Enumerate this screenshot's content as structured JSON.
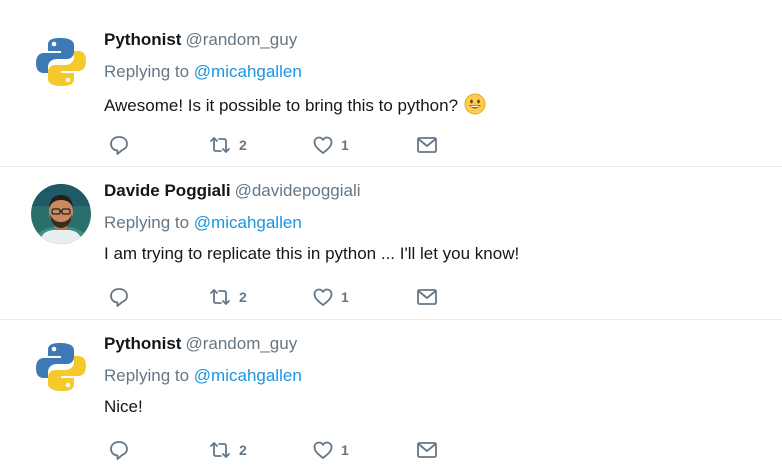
{
  "tweets": [
    {
      "name": "Pythonist",
      "handle": "@random_guy",
      "replying_prefix": "Replying to",
      "replying_to": "@micahgallen",
      "text": "Awesome! Is it possible to bring this to python?",
      "emoji": "grinning-face",
      "avatar": "python-logo",
      "retweets": "2",
      "likes": "1"
    },
    {
      "name": "Davide Poggiali",
      "handle": "@davidepoggiali",
      "replying_prefix": "Replying to",
      "replying_to": "@micahgallen",
      "text": "I am trying to replicate this in python ... I'll let you know!",
      "avatar": "user-photo",
      "retweets": "2",
      "likes": "1"
    },
    {
      "name": "Pythonist",
      "handle": "@random_guy",
      "replying_prefix": "Replying to",
      "replying_to": "@micahgallen",
      "text": "Nice!",
      "avatar": "python-logo",
      "retweets": "2",
      "likes": "1"
    }
  ],
  "colors": {
    "text": "#14171a",
    "secondary": "#657786",
    "link": "#1b95e0",
    "divider": "#e6ecf0",
    "python_blue": "#3d7ab5",
    "python_yellow": "#f5c92b"
  }
}
